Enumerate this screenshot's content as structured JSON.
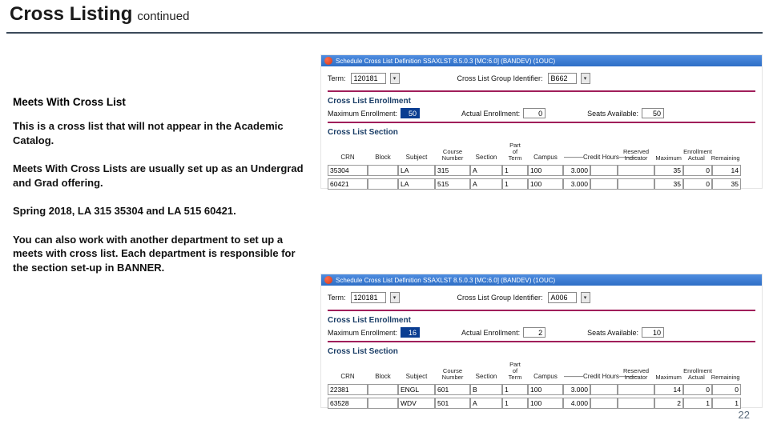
{
  "page": {
    "title": "Cross Listing",
    "subtitle": "continued",
    "number": "22"
  },
  "left": {
    "h": "Meets With Cross List",
    "p1": "This is a cross list that will not appear in the Academic Catalog.",
    "p2": "Meets With Cross Lists are usually set up as an Undergrad and Grad offering.",
    "p3": "Spring 2018, LA 315 35304 and LA 515 60421.",
    "p4": "You can also work with another department to set up a meets with cross list. Each department is responsible for the section set-up in BANNER."
  },
  "labels": {
    "term": "Term:",
    "group": "Cross List Group Identifier:",
    "sec_enroll": "Cross List Enrollment",
    "sec_section": "Cross List Section",
    "max": "Maximum Enrollment:",
    "actual": "Actual Enrollment:",
    "avail": "Seats Available:"
  },
  "headers": {
    "crn": "CRN",
    "block": "Block",
    "subject": "Subject",
    "course_no": "Course\nNumber",
    "section": "Section",
    "part": "Part\nof\nTerm",
    "campus": "Campus",
    "credit": "Credit Hours",
    "reserved": "Reserved\nIndicator",
    "enroll_max": "Maximum",
    "enroll_act": "Actual",
    "enroll_rem": "Remaining",
    "enroll_top": "Enrollment"
  },
  "shot1": {
    "win": "Schedule Cross List Definition SSAXLST 8.5.0.3 [MC:6.0] (BANDEV) (1OUC)",
    "term": "120181",
    "group": "B662",
    "max": "50",
    "actual": "0",
    "avail": "50",
    "rows": [
      {
        "crn": "35304",
        "block": "",
        "subj": "LA",
        "num": "315",
        "sec": "A",
        "pot": "1",
        "campus": "100",
        "cr_lo": "3.000",
        "cr_hi": "",
        "res": "",
        "max": "35",
        "act": "0",
        "rem": "14"
      },
      {
        "crn": "60421",
        "block": "",
        "subj": "LA",
        "num": "515",
        "sec": "A",
        "pot": "1",
        "campus": "100",
        "cr_lo": "3.000",
        "cr_hi": "",
        "res": "",
        "max": "35",
        "act": "0",
        "rem": "35"
      }
    ]
  },
  "shot2": {
    "win": "Schedule Cross List Definition SSAXLST 8.5.0.3 [MC:6.0] (BANDEV) (1OUC)",
    "term": "120181",
    "group": "A006",
    "max": "16",
    "actual": "2",
    "avail": "10",
    "rows": [
      {
        "crn": "22381",
        "block": "",
        "subj": "ENGL",
        "num": "601",
        "sec": "B",
        "pot": "1",
        "campus": "100",
        "cr_lo": "3.000",
        "cr_hi": "",
        "res": "",
        "max": "14",
        "act": "0",
        "rem": "0"
      },
      {
        "crn": "63528",
        "block": "",
        "subj": "WDV",
        "num": "501",
        "sec": "A",
        "pot": "1",
        "campus": "100",
        "cr_lo": "4.000",
        "cr_hi": "",
        "res": "",
        "max": "2",
        "act": "1",
        "rem": "1"
      }
    ]
  }
}
